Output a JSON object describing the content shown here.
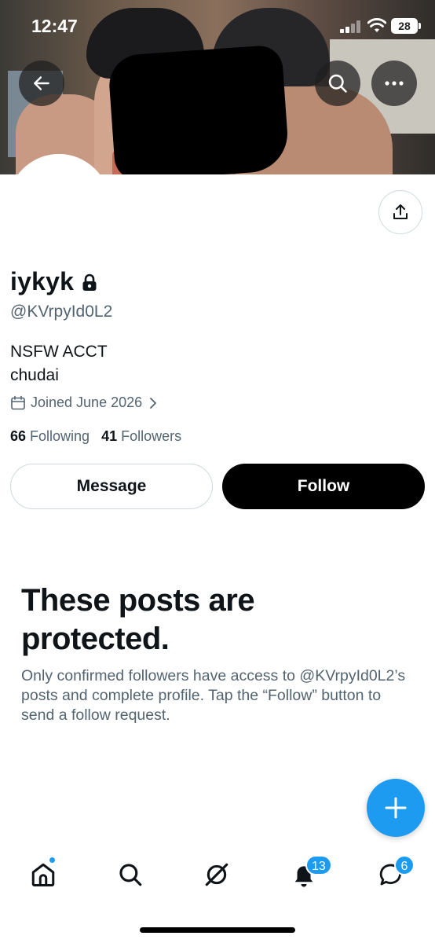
{
  "status_bar": {
    "time": "12:47",
    "battery": "28"
  },
  "header": {
    "back_icon": "arrow-left-icon",
    "search_icon": "search-icon",
    "more_icon": "more-dots-icon"
  },
  "profile": {
    "display_name": "iykyk",
    "protected_icon": "lock-icon",
    "handle": "@KVrpyId0L2",
    "bio_lines": [
      "NSFW ACCT",
      "chudai"
    ],
    "joined": "Joined June 2026",
    "following_count": "66",
    "following_label": "Following",
    "followers_count": "41",
    "followers_label": "Followers",
    "share_icon": "share-icon"
  },
  "actions": {
    "message_label": "Message",
    "follow_label": "Follow"
  },
  "protected": {
    "title": "These posts are protected.",
    "body": "Only confirmed followers have access to @KVrpyId0L2’s posts and complete profile. Tap the “Follow” button to send a follow request."
  },
  "fab": {
    "icon": "plus-icon"
  },
  "bottom_nav": {
    "items": [
      {
        "icon": "home-icon",
        "has_dot": true
      },
      {
        "icon": "search-icon"
      },
      {
        "icon": "grok-icon"
      },
      {
        "icon": "bell-icon",
        "badge": "13"
      },
      {
        "icon": "messages-icon",
        "badge": "6"
      }
    ]
  },
  "colors": {
    "accent": "#1d9bf0",
    "text_primary": "#0f1419",
    "text_secondary": "#536471",
    "follow_button": "#000000"
  }
}
